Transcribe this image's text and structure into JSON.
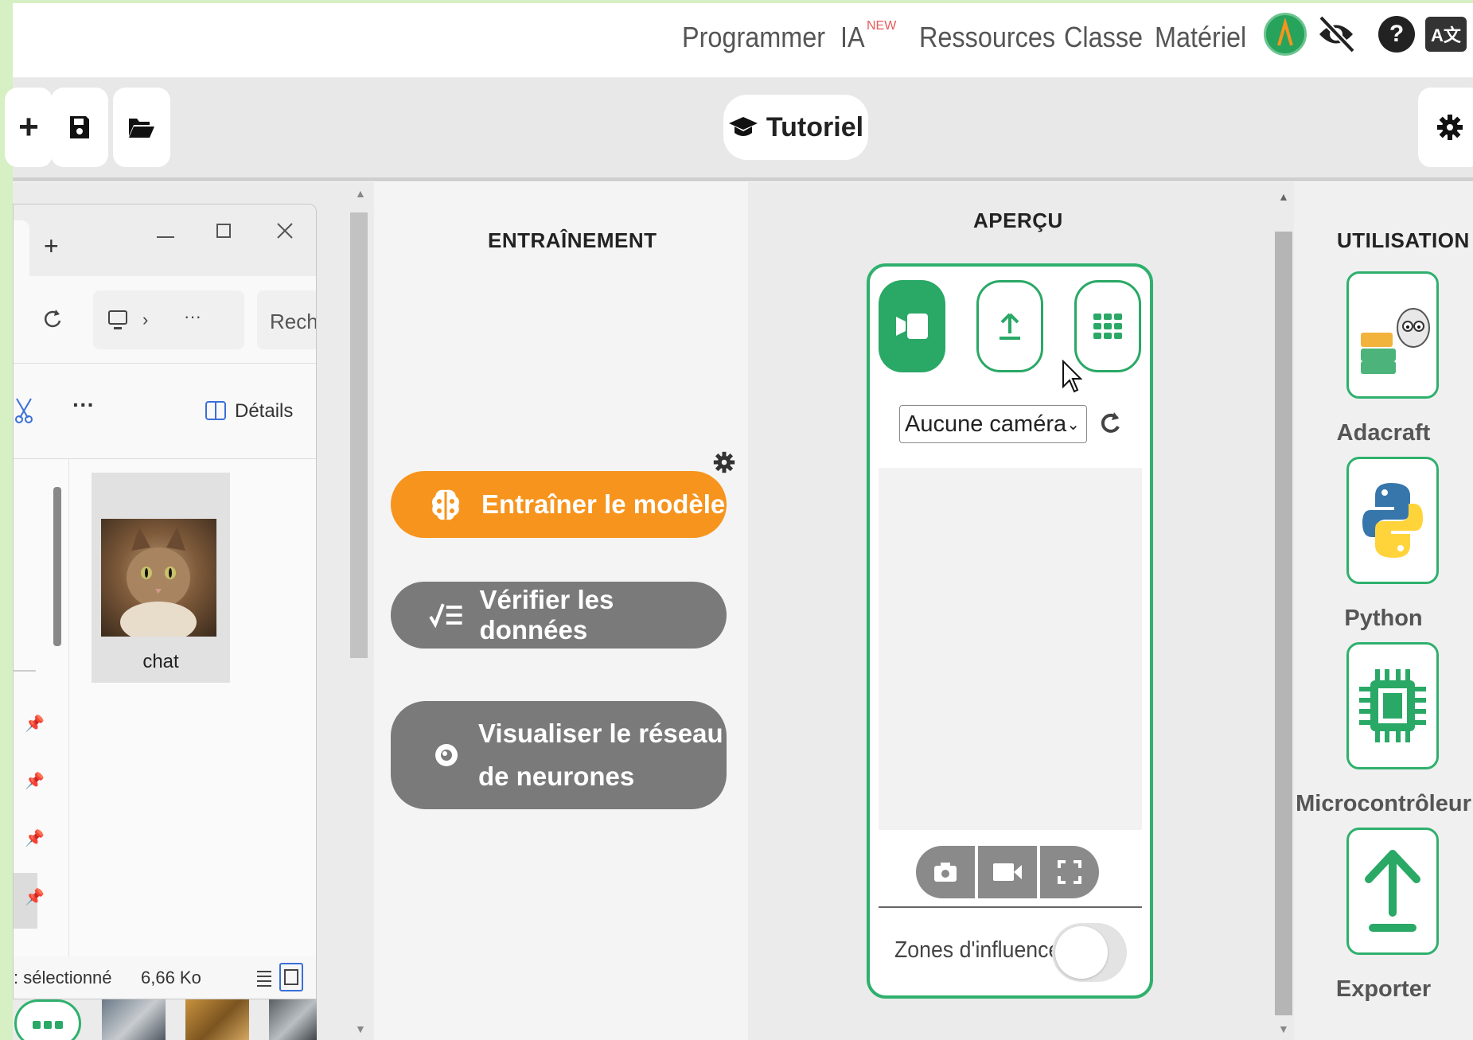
{
  "nav": {
    "programmer": "Programmer",
    "ia": "IA",
    "ia_badge": "NEW",
    "resources": "Ressources",
    "classe": "Classe",
    "materiel": "Matériel",
    "avatar_letter": "A",
    "help_glyph": "?",
    "lang_glyph": "A文"
  },
  "toolbar": {
    "new_glyph": "+",
    "tutorial_label": "Tutoriel"
  },
  "explorer": {
    "new_tab_glyph": "+",
    "search_placeholder": "Rech",
    "details_label": "Détails",
    "more_glyph": "···",
    "file_name": "chat",
    "status_selected": ": sélectionné",
    "status_size": "6,66 Ko"
  },
  "training": {
    "header": "ENTRAÎNEMENT",
    "train_button": "Entraîner le modèle",
    "verify_button": "Vérifier les données",
    "visualize_line1": "Visualiser le réseau",
    "visualize_line2": "de neurones"
  },
  "preview": {
    "header": "APERÇU",
    "camera_value": "Aucune caméra",
    "influence_label": "Zones d'influence",
    "influence_enabled": false
  },
  "usage": {
    "header": "UTILISATION",
    "items": [
      {
        "label": "Adacraft",
        "icon": "adacraft-icon"
      },
      {
        "label": "Python",
        "icon": "python-icon"
      },
      {
        "label": "Microcontrôleur",
        "icon": "chip-icon"
      },
      {
        "label": "Exporter",
        "icon": "upload-icon"
      }
    ]
  },
  "colors": {
    "accent_green": "#2aa866",
    "train_orange": "#f7941d",
    "pill_gray": "#7a7a7a"
  }
}
